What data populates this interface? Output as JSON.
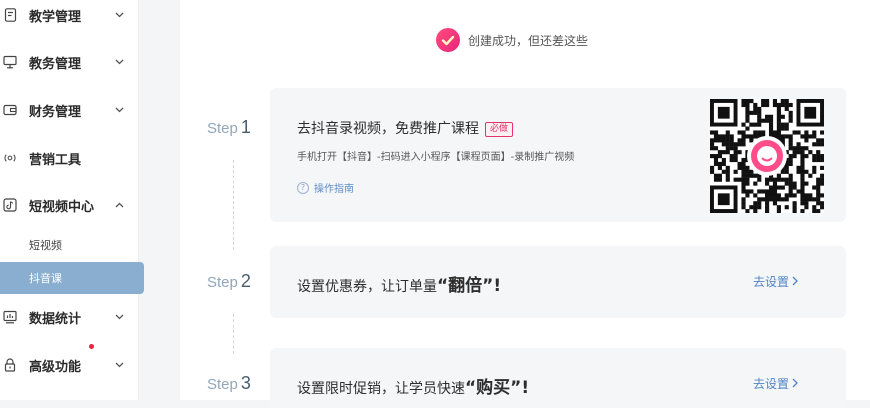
{
  "sidebar": {
    "items": [
      {
        "label": "教学管理",
        "icon": "document-icon"
      },
      {
        "label": "教务管理",
        "icon": "monitor-icon"
      },
      {
        "label": "财务管理",
        "icon": "wallet-icon"
      },
      {
        "label": "营销工具",
        "icon": "broadcast-icon"
      },
      {
        "label": "短视频中心",
        "icon": "tiktok-icon"
      },
      {
        "label": "数据统计",
        "icon": "chart-icon"
      },
      {
        "label": "高级功能",
        "icon": "lock-icon"
      }
    ],
    "subitems": [
      {
        "label": "短视频"
      },
      {
        "label": "抖音课"
      }
    ]
  },
  "main": {
    "success_text": "创建成功，但还差这些",
    "steps": [
      {
        "step_word": "Step",
        "number": "1",
        "title": "去抖音录视频，免费推广课程",
        "badge": "必做",
        "desc": "手机打开【抖音】-扫码进入小程序【课程页面】-录制推广视频",
        "guide": "操作指南"
      },
      {
        "step_word": "Step",
        "number": "2",
        "title_prefix": "设置优惠券，让订单量",
        "title_emph": "“翻倍”!",
        "link": "去设置"
      },
      {
        "step_word": "Step",
        "number": "3",
        "title_prefix": "设置限时促销，让学员快速",
        "title_emph": "“购买”!",
        "link": "去设置"
      }
    ]
  },
  "colors": {
    "accent_pink": "#e8336a",
    "active_nav": "#8aaed0",
    "link_blue": "#4f84c8"
  }
}
